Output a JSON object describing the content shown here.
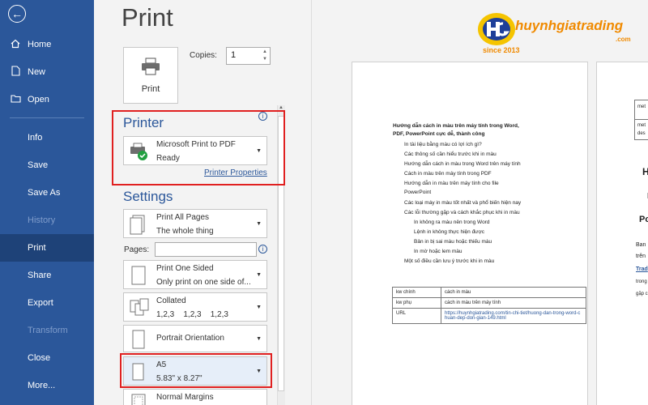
{
  "nav": {
    "back_label": "←",
    "items": [
      {
        "label": "Home",
        "icon": "home-icon"
      },
      {
        "label": "New",
        "icon": "new-document-icon"
      },
      {
        "label": "Open",
        "icon": "folder-open-icon"
      },
      {
        "label": "Info"
      },
      {
        "label": "Save"
      },
      {
        "label": "Save As"
      },
      {
        "label": "History"
      },
      {
        "label": "Print"
      },
      {
        "label": "Share"
      },
      {
        "label": "Export"
      },
      {
        "label": "Transform"
      },
      {
        "label": "Close"
      },
      {
        "label": "More..."
      }
    ],
    "active": "Print",
    "colors": {
      "bg": "#2b579a",
      "active_bg": "#1e4278"
    }
  },
  "print": {
    "title": "Print",
    "button_label": "Print",
    "copies_label": "Copies:",
    "copies_value": "1",
    "printer_section": "Printer",
    "printer_name": "Microsoft Print to PDF",
    "printer_status": "Ready",
    "printer_properties": "Printer Properties",
    "settings_section": "Settings",
    "pages_label": "Pages:",
    "settings": [
      {
        "main": "Print All Pages",
        "sub": "The whole thing"
      },
      {
        "main": "Print One Sided",
        "sub": "Only print on one side of..."
      },
      {
        "main": "Collated",
        "sub": "1,2,3    1,2,3    1,2,3"
      },
      {
        "main": "Portrait Orientation",
        "sub": ""
      },
      {
        "main": "A5",
        "sub": "5.83\" x 8.27\""
      },
      {
        "main": "Normal Margins",
        "sub": ""
      }
    ]
  },
  "preview": {
    "title_line1": "Hướng dẫn cách in màu trên máy tính trong Word,",
    "title_line2": "PDF, PowerPoint cực dễ, thành công",
    "toc": [
      "In tài liệu bằng màu có lợi ích gì?",
      "Các thông số cần hiểu trước khi in màu",
      "Hướng dẫn cách in màu trong Word trên máy tính",
      "Cách in màu trên máy tính trong PDF",
      "Hướng dẫn in màu trên máy tính cho file",
      "PowerPoint",
      "Các loại máy in màu tốt nhất và phổ biến hiện nay",
      "Các lỗi thường gặp và cách khắc phục khi in màu",
      "In không ra màu nên trong Word",
      "Lệnh in không thực hiện được",
      "Bản in bị sai màu hoặc thiếu màu",
      "In mờ hoặc lem màu",
      "Một số điều cần lưu ý trước khi in màu"
    ],
    "table": [
      {
        "key": "kw chính",
        "value": "cách in màu"
      },
      {
        "key": "kw phụ",
        "value": "cách in màu trên máy tính"
      },
      {
        "key": "URL",
        "value": "https://huynhgiatrading.com/tin-chi-tiet/huong-dan-trong-word-chuan-dep-don-gian-149.html"
      }
    ],
    "page2_fragments": [
      "met",
      "met",
      "des",
      "H",
      "I",
      "Po",
      "Ban",
      "trên",
      "Trad",
      "trong",
      "gặp c"
    ]
  },
  "logo": {
    "text": "huynhgiatrading",
    "com": ".com",
    "since": "since 2013"
  },
  "colors": {
    "accent": "#2b579a",
    "highlight": "#e02020",
    "logo_orange": "#f08a00",
    "logo_blue": "#1e3f99"
  }
}
